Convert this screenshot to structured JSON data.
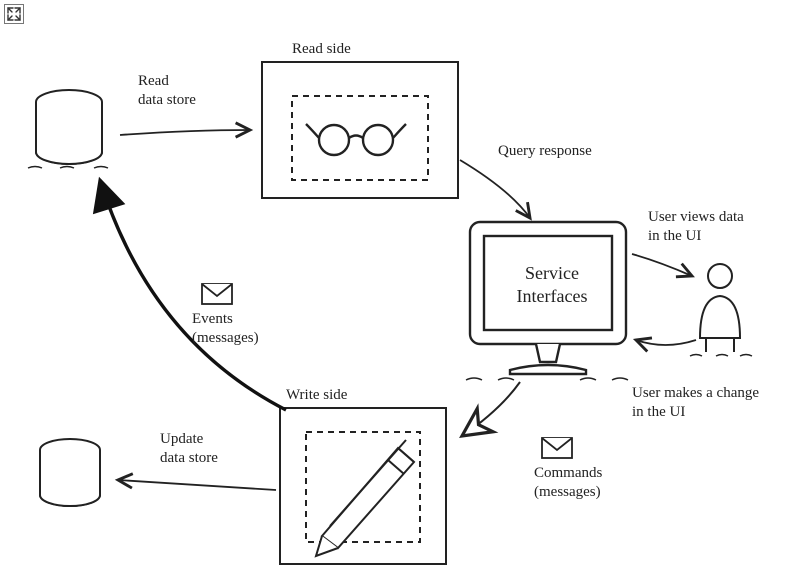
{
  "labels": {
    "read_data_store": "Read\ndata store",
    "read_side": "Read side",
    "query_response": "Query response",
    "events": "Events\n(messages)",
    "user_views": "User views data\nin the UI",
    "service_interfaces": "Service\nInterfaces",
    "user_change": "User makes a change\nin the UI",
    "write_side": "Write side",
    "update_data_store": "Update\ndata store",
    "commands": "Commands\n(messages)"
  },
  "icons": {
    "expand": "expand-icon",
    "db_top": "cylinder-read-store",
    "db_bottom": "cylinder-write-store",
    "glasses": "glasses-icon",
    "pencil": "pencil-icon",
    "monitor": "monitor-icon",
    "person": "person-icon",
    "envelope_events": "envelope-icon",
    "envelope_commands": "envelope-icon"
  }
}
